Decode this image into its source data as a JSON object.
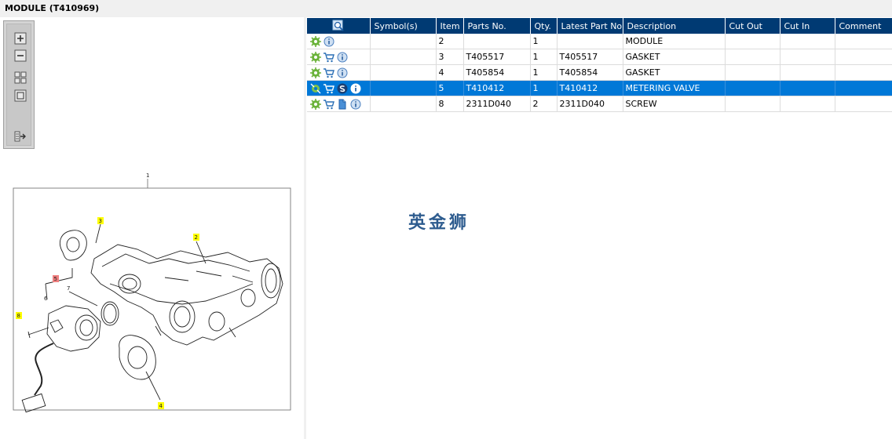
{
  "window": {
    "title": "MODULE (T410969)"
  },
  "watermark": "英金狮",
  "toolbar": {
    "buttons": [
      {
        "icon": "zoom-in-icon"
      },
      {
        "icon": "zoom-out-icon"
      },
      {
        "icon": "fit-all-icon"
      },
      {
        "icon": "actual-size-icon"
      },
      {
        "icon": "export-icon"
      }
    ]
  },
  "drawing": {
    "callouts": {
      "main": "1",
      "module": "2",
      "gasket_top": "3",
      "gasket_bottom": "4",
      "valve_group": "5",
      "part6": "6",
      "part7": "7",
      "screw": "8"
    }
  },
  "table": {
    "headers": {
      "symbols": "Symbol(s)",
      "item": "Item",
      "parts_no": "Parts No.",
      "qty": "Qty.",
      "latest": "Latest Part No.",
      "description": "Description",
      "cut_out": "Cut Out",
      "cut_in": "Cut In",
      "comment": "Comment"
    },
    "rows": [
      {
        "item": "2",
        "parts_no": "",
        "qty": "1",
        "latest": "",
        "description": "MODULE",
        "cut_out": "",
        "cut_in": "",
        "comment": ""
      },
      {
        "item": "3",
        "parts_no": "T405517",
        "qty": "1",
        "latest": "T405517",
        "description": "GASKET",
        "cut_out": "",
        "cut_in": "",
        "comment": ""
      },
      {
        "item": "4",
        "parts_no": "T405854",
        "qty": "1",
        "latest": "T405854",
        "description": "GASKET",
        "cut_out": "",
        "cut_in": "",
        "comment": ""
      },
      {
        "item": "5",
        "parts_no": "T410412",
        "qty": "1",
        "latest": "T410412",
        "description": "METERING VALVE",
        "cut_out": "",
        "cut_in": "",
        "comment": ""
      },
      {
        "item": "8",
        "parts_no": "2311D040",
        "qty": "2",
        "latest": "2311D040",
        "description": "SCREW",
        "cut_out": "",
        "cut_in": "",
        "comment": ""
      }
    ]
  },
  "colors": {
    "header_bg": "#003a73",
    "selected_row": "#0078d7",
    "callout_yellow": "#ffff00",
    "callout_red": "#f08080"
  }
}
